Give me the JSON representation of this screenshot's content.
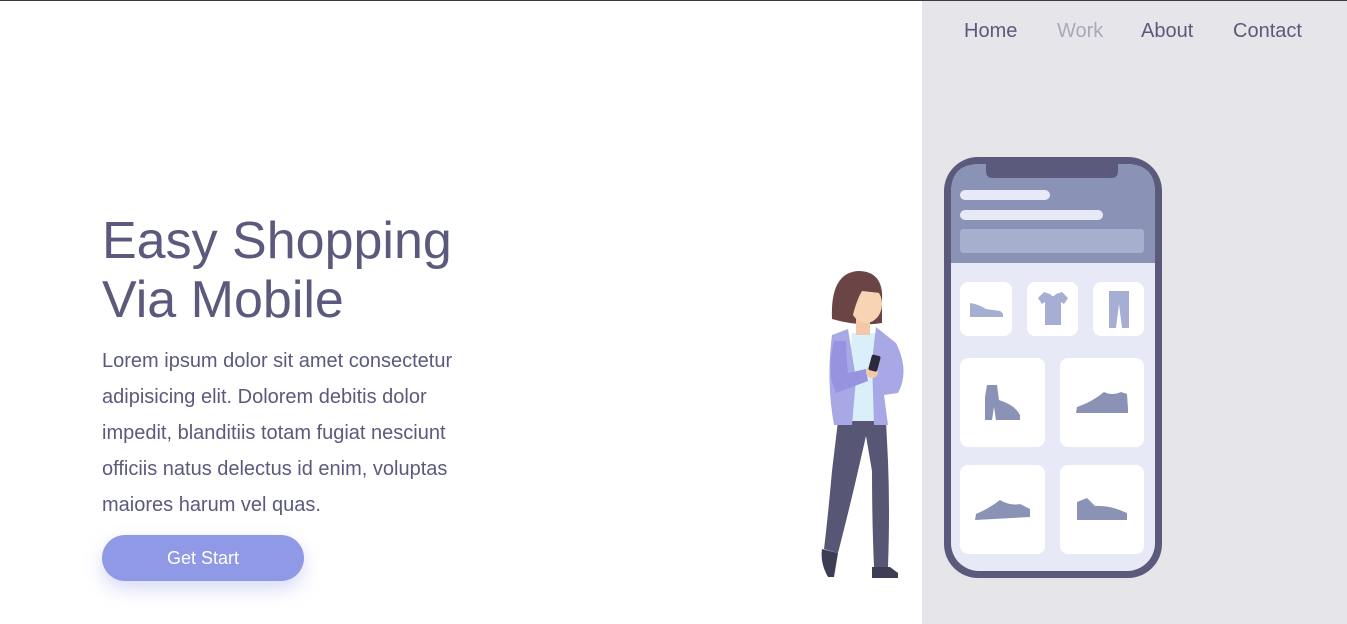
{
  "nav": {
    "items": [
      {
        "label": "Home",
        "active": false
      },
      {
        "label": "Work",
        "active": true
      },
      {
        "label": "About",
        "active": false
      },
      {
        "label": "Contact",
        "active": false
      }
    ]
  },
  "hero": {
    "title": "Easy Shopping Via Mobile",
    "description": "Lorem ipsum dolor sit amet consectetur adipisicing elit. Dolorem debitis dolor impedit, blanditiis totam fugiat nesciunt officiis natus delectus id enim, voluptas maiores harum vel quas.",
    "cta_label": "Get Start"
  },
  "colors": {
    "text": "#5b5a7c",
    "nav_active": "#a9a8bd",
    "accent": "#9099e6",
    "panel_bg": "#e6e5ea",
    "phone_frame": "#5b5a7c"
  },
  "illustration": {
    "icons": [
      "flat-shoe-icon",
      "tshirt-icon",
      "pants-icon",
      "high-heel-icon",
      "sneaker-icon",
      "sneaker-icon",
      "sneaker-icon"
    ]
  }
}
